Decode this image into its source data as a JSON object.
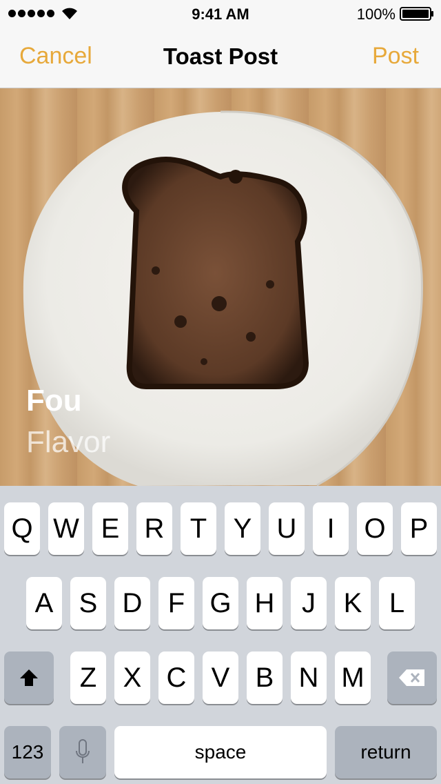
{
  "status_bar": {
    "time": "9:41 AM",
    "battery": "100%"
  },
  "nav": {
    "cancel": "Cancel",
    "title": "Toast Post",
    "post": "Post"
  },
  "photo": {
    "name": "Fou",
    "flavor": "Flavor"
  },
  "keyboard": {
    "row1": [
      "Q",
      "W",
      "E",
      "R",
      "T",
      "Y",
      "U",
      "I",
      "O",
      "P"
    ],
    "row2": [
      "A",
      "S",
      "D",
      "F",
      "G",
      "H",
      "J",
      "K",
      "L"
    ],
    "row3": [
      "Z",
      "X",
      "C",
      "V",
      "B",
      "N",
      "M"
    ],
    "numbers": "123",
    "space": "space",
    "return": "return"
  },
  "colors": {
    "accent": "#e7a93b",
    "keyboard_bg": "#d1d5db",
    "key_dark": "#acb3bd"
  }
}
